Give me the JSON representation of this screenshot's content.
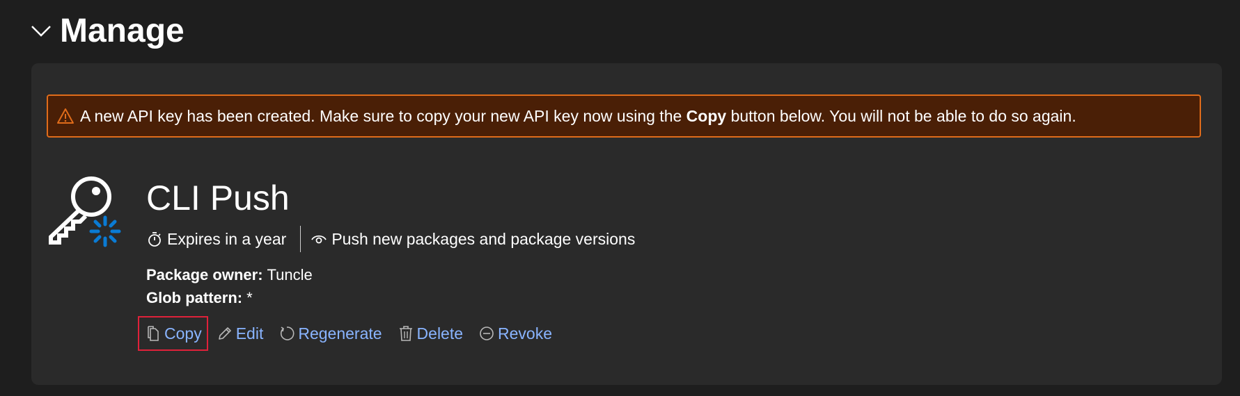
{
  "section": {
    "title": "Manage",
    "icon": "chevron-down-icon"
  },
  "alert": {
    "icon": "warning-icon",
    "text_before": "A new API key has been created. Make sure to copy your new API key now using the",
    "bold": "Copy",
    "text_after": "button below. You will not be able to do so again.",
    "border_color": "#e06c1a",
    "background_color": "#4a1f06"
  },
  "key": {
    "icon": "api-key-icon",
    "name": "CLI Push",
    "expires": "Expires in a year",
    "scope": "Push new packages and package versions",
    "owner_label": "Package owner:",
    "owner_value": "Tuncle",
    "glob_label": "Glob pattern:",
    "glob_value": "*"
  },
  "actions": {
    "copy": "Copy",
    "edit": "Edit",
    "regenerate": "Regenerate",
    "delete": "Delete",
    "revoke": "Revoke"
  },
  "colors": {
    "link": "#89b4ff",
    "accent_blue": "#0a7bd4",
    "highlight_box": "#e0213a"
  }
}
